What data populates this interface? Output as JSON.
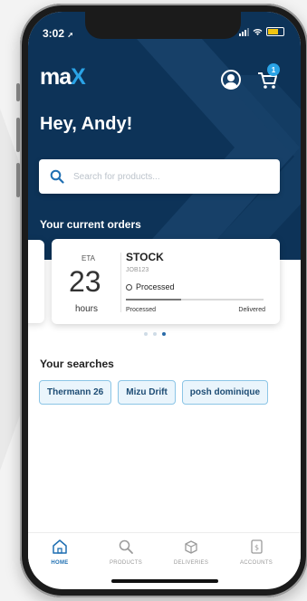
{
  "status": {
    "time": "3:02"
  },
  "brand": {
    "logo_prefix": "ma",
    "logo_x": "X"
  },
  "header": {
    "cart_count": "1",
    "greeting": "Hey, Andy!"
  },
  "search": {
    "placeholder": "Search for products..."
  },
  "orders": {
    "title": "Your current orders",
    "card": {
      "eta_label": "ETA",
      "eta_value": "23",
      "eta_unit": "hours",
      "name": "STOCK",
      "job": "JOB123",
      "status": "Processed",
      "progress": 0.4,
      "progress_start": "Processed",
      "progress_end": "Delivered"
    },
    "pager": {
      "count": 3,
      "active": 2
    }
  },
  "searches": {
    "title": "Your searches",
    "items": [
      "Thermann 26",
      "Mizu Drift",
      "posh dominique"
    ]
  },
  "tabs": [
    {
      "label": "HOME",
      "icon": "home-icon",
      "active": true
    },
    {
      "label": "PRODUCTS",
      "icon": "search-icon",
      "active": false
    },
    {
      "label": "DELIVERIES",
      "icon": "package-icon",
      "active": false
    },
    {
      "label": "ACCOUNTS",
      "icon": "invoice-icon",
      "active": false
    }
  ],
  "colors": {
    "hero": "#0d3358",
    "accent": "#2aa3e6",
    "active_tab": "#1f6fb2"
  }
}
